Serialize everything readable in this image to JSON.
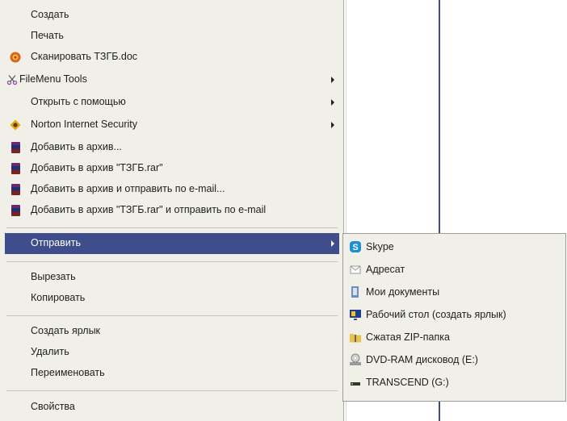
{
  "context_menu": {
    "items": [
      {
        "label": "Создать",
        "icon": "none"
      },
      {
        "label": "Печать",
        "icon": "none"
      },
      {
        "label": "Сканировать ТЗГБ.doc",
        "icon": "antivirus-scan-icon"
      },
      {
        "label": "FileMenu Tools",
        "icon": "scissors-icon",
        "submenu": true
      },
      {
        "label": "Открыть с помощью",
        "icon": "none",
        "submenu": true
      },
      {
        "label": "Norton Internet Security",
        "icon": "norton-icon",
        "submenu": true
      },
      {
        "label": "Добавить в архив...",
        "icon": "winrar-icon"
      },
      {
        "label": "Добавить в архив \"ТЗГБ.rar\"",
        "icon": "winrar-icon"
      },
      {
        "label": "Добавить в архив и отправить по e-mail...",
        "icon": "winrar-icon"
      },
      {
        "label": "Добавить в архив \"ТЗГБ.rar\" и отправить по e-mail",
        "icon": "winrar-icon"
      },
      {
        "label": "Отправить",
        "icon": "none",
        "submenu": true,
        "selected": true
      },
      {
        "label": "Вырезать",
        "icon": "none"
      },
      {
        "label": "Копировать",
        "icon": "none"
      },
      {
        "label": "Создать ярлык",
        "icon": "none"
      },
      {
        "label": "Удалить",
        "icon": "none"
      },
      {
        "label": "Переименовать",
        "icon": "none"
      },
      {
        "label": "Свойства",
        "icon": "none"
      }
    ]
  },
  "send_to_submenu": {
    "items": [
      {
        "label": "Skype",
        "icon": "skype-icon"
      },
      {
        "label": "Адресат",
        "icon": "mail-recipient-icon"
      },
      {
        "label": "Мои документы",
        "icon": "my-documents-icon"
      },
      {
        "label": "Рабочий стол (создать ярлык)",
        "icon": "desktop-icon"
      },
      {
        "label": "Сжатая ZIP-папка",
        "icon": "zip-folder-icon"
      },
      {
        "label": "DVD-RAM дисковод (E:)",
        "icon": "dvd-drive-icon"
      },
      {
        "label": "TRANSCEND (G:)",
        "icon": "usb-drive-icon"
      }
    ]
  },
  "colors": {
    "menu_bg": "#f0efe8",
    "highlight": "#3f4d8c",
    "separator": "#c5c4bc"
  }
}
